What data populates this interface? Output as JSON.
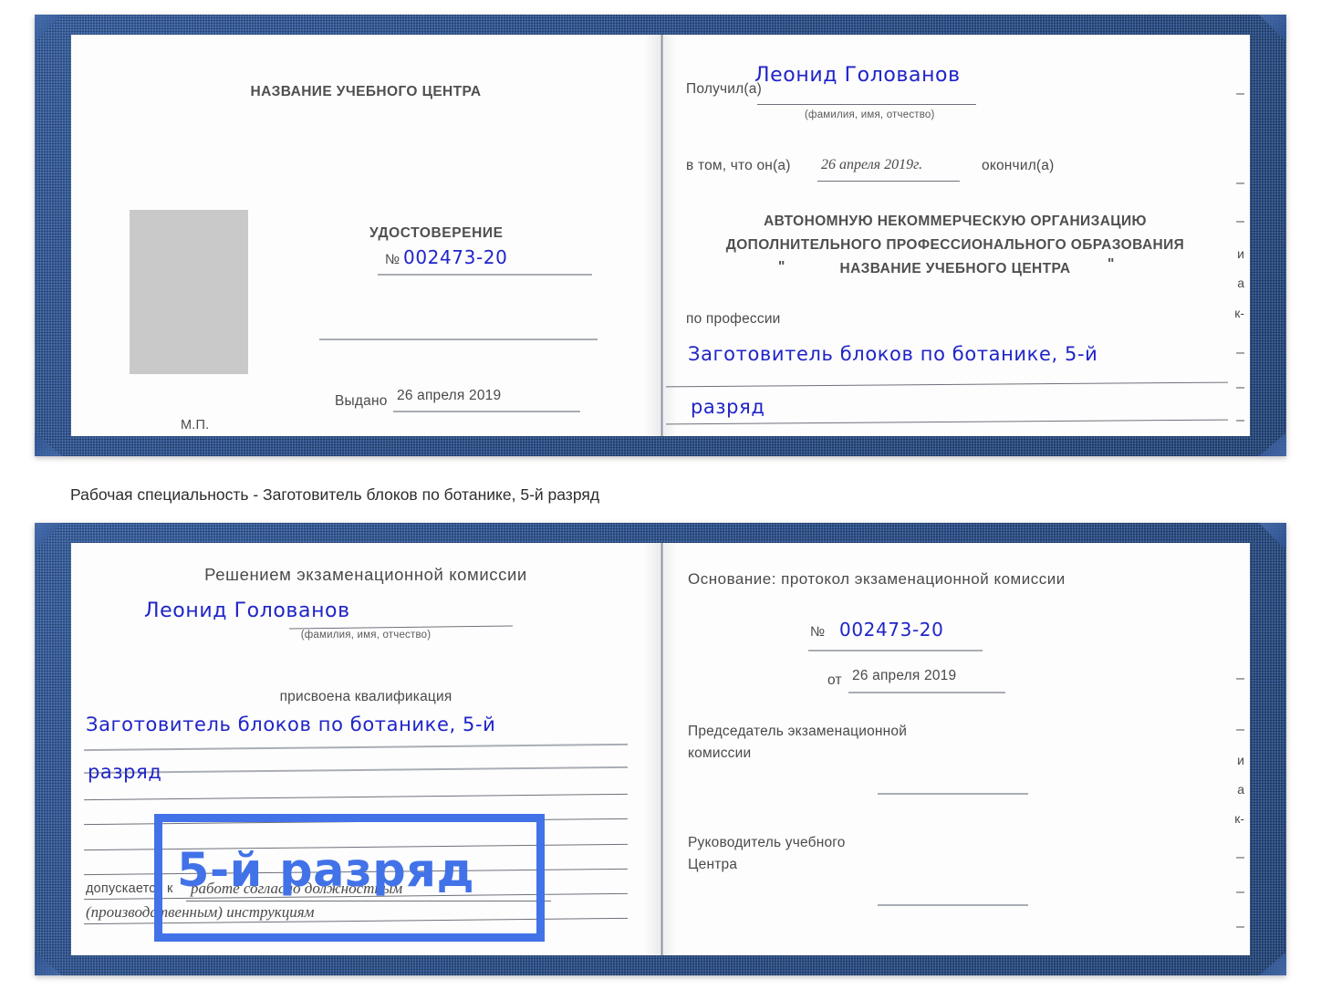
{
  "caption": {
    "text": "Рабочая специальность - Заготовитель блоков по ботанике, 5-й разряд"
  },
  "certificate_top": {
    "left_page": {
      "center_name": "НАЗВАНИЕ УЧЕБНОГО ЦЕНТРА",
      "doc_type": "УДОСТОВЕРЕНИЕ",
      "number_label": "№",
      "number_value": "002473-20",
      "issued_label": "Выдано",
      "issued_value": "26 апреля 2019",
      "stamp_label": "М.П.",
      "photo_placeholder": "photo-placeholder"
    },
    "right_page": {
      "received_label": "Получил(а)",
      "received_value": "Леонид Голованов",
      "fio_hint": "(фамилия, имя, отчество)",
      "in_that_label": "в том, что он(а)",
      "in_that_value": "26 апреля 2019г.",
      "finished_label": "окончил(а)",
      "org_line1": "АВТОНОМНУЮ НЕКОММЕРЧЕСКУЮ ОРГАНИЗАЦИЮ",
      "org_line2": "ДОПОЛНИТЕЛЬНОГО ПРОФЕССИОНАЛЬНОГО ОБРАЗОВАНИЯ",
      "org_quote_open": "\"",
      "org_line3": "НАЗВАНИЕ УЧЕБНОГО ЦЕНТРА",
      "org_quote_close": "\"",
      "profession_label": "по профессии",
      "profession_value_line1": "Заготовитель блоков по ботанике, 5-й",
      "profession_value_line2": "разряд"
    }
  },
  "certificate_bottom": {
    "left_page": {
      "decision_title": "Решением экзаменационной комиссии",
      "name_value": "Леонид Голованов",
      "fio_hint": "(фамилия, имя, отчество)",
      "qualification_label": "присвоена квалификация",
      "qualification_value_line1": "Заготовитель блоков по ботанике, 5-й",
      "qualification_value_line2": "разряд",
      "allowed_label": "допускается к",
      "allowed_value_line1": "работе согласно должностным",
      "allowed_value_line2": "(производственным) инструкциям",
      "highlight_text": "5-й разряд"
    },
    "right_page": {
      "basis_label": "Основание: протокол экзаменационной комиссии",
      "number_label": "№",
      "number_value": "002473-20",
      "date_label": "от",
      "date_value": "26 апреля 2019",
      "chairman_line1": "Председатель экзаменационной",
      "chairman_line2": "комиссии",
      "head_line1": "Руководитель учебного",
      "head_line2": "Центра"
    }
  },
  "margin_fragments": {
    "top": [
      "–",
      "–",
      "–",
      "и",
      "а",
      "к-",
      "–",
      "–",
      "–"
    ],
    "bottom": [
      "–",
      "–",
      "и",
      "а",
      "к-",
      "–",
      "–",
      "–"
    ]
  },
  "colors": {
    "cover_blue": "#244a86",
    "handwriting_blue": "#1f24c8",
    "highlight_blue": "#4272e8",
    "page_white": "#fdfdfd",
    "text_gray": "#4a4a4a",
    "rule_gray": "#a9adb4"
  }
}
